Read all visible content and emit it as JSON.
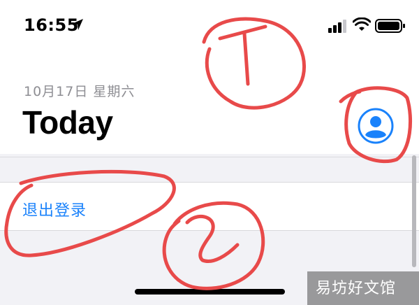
{
  "status_bar": {
    "time": "16:55",
    "location_icon": "location-arrow-icon",
    "signal_icon": "cellular-signal-icon",
    "wifi_icon": "wifi-icon",
    "battery_icon": "battery-icon"
  },
  "header": {
    "date": "10月17日 星期六",
    "title": "Today",
    "account_icon": "person-circle-icon"
  },
  "menu": {
    "sign_out_label": "退出登录"
  },
  "annotations": {
    "marks": [
      "1",
      "2"
    ],
    "color": "#e84a4a"
  },
  "watermark": {
    "text": "易坊好文馆"
  },
  "colors": {
    "accent": "#1a82fb",
    "background": "#f2f2f6",
    "annotation": "#e84a4a"
  }
}
